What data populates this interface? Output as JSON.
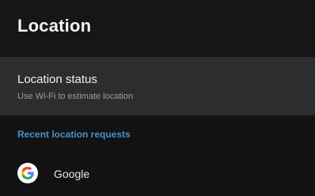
{
  "header": {
    "title": "Location"
  },
  "location_status": {
    "title": "Location status",
    "subtitle": "Use Wi-Fi to estimate location"
  },
  "recent_requests": {
    "section_label": "Recent location requests",
    "items": [
      {
        "label": "Google",
        "icon": "google-icon"
      }
    ]
  },
  "colors": {
    "accent": "#4a90c8",
    "background": "#121212",
    "selected_row": "#2b2d2f"
  }
}
